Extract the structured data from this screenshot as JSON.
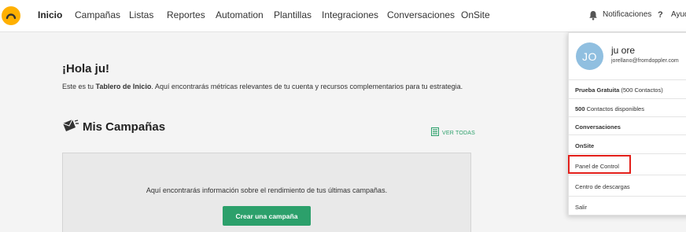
{
  "nav": {
    "items": [
      "Inicio",
      "Campañas",
      "Listas",
      "Reportes",
      "Automation",
      "Plantillas",
      "Integraciones",
      "Conversaciones",
      "OnSite"
    ],
    "notifications_label": "Notificaciones",
    "help_label": "Ayuda",
    "help_glyph": "?"
  },
  "main": {
    "greeting": "¡Hola ju!",
    "intro_pre": "Este es tu ",
    "intro_bold": "Tablero de Inicio",
    "intro_post": ". Aquí encontrarás métricas relevantes de tu cuenta y recursos complementarios para tu estrategia.",
    "campaigns_title": "Mis Campañas",
    "see_all": "VER TODAS",
    "empty_message": "Aquí encontrarás información sobre el rendimiento de tus últimas campañas.",
    "create_button": "Crear una campaña"
  },
  "user_menu": {
    "avatar_initials": "JO",
    "name": "ju ore",
    "email": "jorellano@fromdoppler.com",
    "plan_bold": "Prueba Gratuita",
    "plan_rest": " (500 Contactos)",
    "contacts_bold": "500",
    "contacts_rest": " Contactos disponibles",
    "conversations": "Conversaciones",
    "onsite": "OnSite",
    "control_panel": "Panel de Control",
    "downloads": "Centro de descargas",
    "logout": "Salir"
  },
  "colors": {
    "brand_yellow": "#ffb000",
    "accent_green": "#2ca06b",
    "highlight_red": "#e3201b",
    "avatar_blue": "#90bfe0"
  },
  "icons": [
    "doppler-logo-icon",
    "bell-icon",
    "help-icon",
    "campaign-icon",
    "list-icon"
  ]
}
